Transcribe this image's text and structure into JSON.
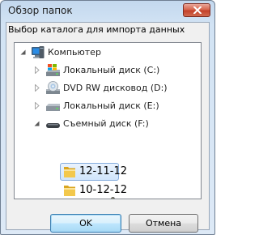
{
  "window": {
    "title": "Обзор папок",
    "description": "Выбор каталога для импорта данных"
  },
  "tree": {
    "items": [
      {
        "label": "Компьютер",
        "icon": "computer-icon",
        "expander": "expanded"
      },
      {
        "label": "Локальный диск (C:)",
        "icon": "windows-drive-icon",
        "expander": "collapsed"
      },
      {
        "label": "DVD RW дисковод (D:)",
        "icon": "dvd-drive-icon",
        "expander": "collapsed"
      },
      {
        "label": "Локальный диск (E:)",
        "icon": "hard-drive-icon",
        "expander": "collapsed"
      },
      {
        "label": "Съемный диск (F:)",
        "icon": "removable-drive-icon",
        "expander": "expanded"
      },
      {
        "label": "12-11-12",
        "icon": "folder-icon",
        "selected": true
      },
      {
        "label": "10-12-12",
        "icon": "folder-icon"
      }
    ]
  },
  "buttons": {
    "ok": "OK",
    "cancel": "Отмена"
  },
  "colors": {
    "window_frame": "#d2e3f4",
    "close_button": "#c4412a",
    "selection": "#d0e5fc",
    "default_button": "#bee6fd",
    "folder": "#f3c84c"
  }
}
